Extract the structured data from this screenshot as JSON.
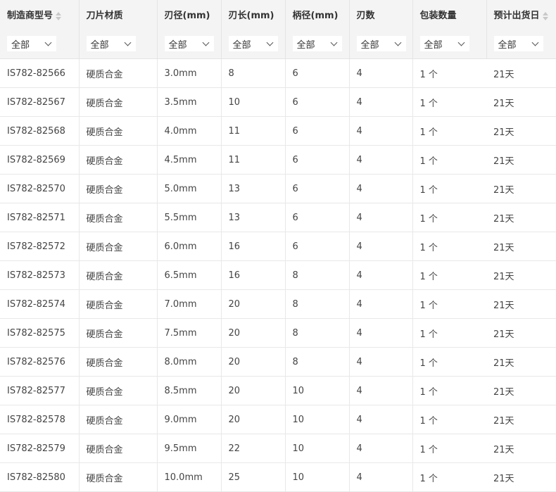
{
  "columns": [
    {
      "label": "制造商型号",
      "sortable": true
    },
    {
      "label": "刀片材质",
      "sortable": false
    },
    {
      "label": "刃径(mm)",
      "sortable": false
    },
    {
      "label": "刃长(mm)",
      "sortable": false
    },
    {
      "label": "柄径(mm)",
      "sortable": false
    },
    {
      "label": "刃数",
      "sortable": false
    },
    {
      "label": "包装数量",
      "sortable": false
    },
    {
      "label": "预计出货日",
      "sortable": true
    }
  ],
  "filter_label": "全部",
  "rows": [
    [
      "IS782-82566",
      "硬质合金",
      "3.0mm",
      "8",
      "6",
      "4",
      "1 个",
      "21天"
    ],
    [
      "IS782-82567",
      "硬质合金",
      "3.5mm",
      "10",
      "6",
      "4",
      "1 个",
      "21天"
    ],
    [
      "IS782-82568",
      "硬质合金",
      "4.0mm",
      "11",
      "6",
      "4",
      "1 个",
      "21天"
    ],
    [
      "IS782-82569",
      "硬质合金",
      "4.5mm",
      "11",
      "6",
      "4",
      "1 个",
      "21天"
    ],
    [
      "IS782-82570",
      "硬质合金",
      "5.0mm",
      "13",
      "6",
      "4",
      "1 个",
      "21天"
    ],
    [
      "IS782-82571",
      "硬质合金",
      "5.5mm",
      "13",
      "6",
      "4",
      "1 个",
      "21天"
    ],
    [
      "IS782-82572",
      "硬质合金",
      "6.0mm",
      "16",
      "6",
      "4",
      "1 个",
      "21天"
    ],
    [
      "IS782-82573",
      "硬质合金",
      "6.5mm",
      "16",
      "8",
      "4",
      "1 个",
      "21天"
    ],
    [
      "IS782-82574",
      "硬质合金",
      "7.0mm",
      "20",
      "8",
      "4",
      "1 个",
      "21天"
    ],
    [
      "IS782-82575",
      "硬质合金",
      "7.5mm",
      "20",
      "8",
      "4",
      "1 个",
      "21天"
    ],
    [
      "IS782-82576",
      "硬质合金",
      "8.0mm",
      "20",
      "8",
      "4",
      "1 个",
      "21天"
    ],
    [
      "IS782-82577",
      "硬质合金",
      "8.5mm",
      "20",
      "10",
      "4",
      "1 个",
      "21天"
    ],
    [
      "IS782-82578",
      "硬质合金",
      "9.0mm",
      "20",
      "10",
      "4",
      "1 个",
      "21天"
    ],
    [
      "IS782-82579",
      "硬质合金",
      "9.5mm",
      "22",
      "10",
      "4",
      "1 个",
      "21天"
    ],
    [
      "IS782-82580",
      "硬质合金",
      "10.0mm",
      "25",
      "10",
      "4",
      "1 个",
      "21天"
    ]
  ]
}
